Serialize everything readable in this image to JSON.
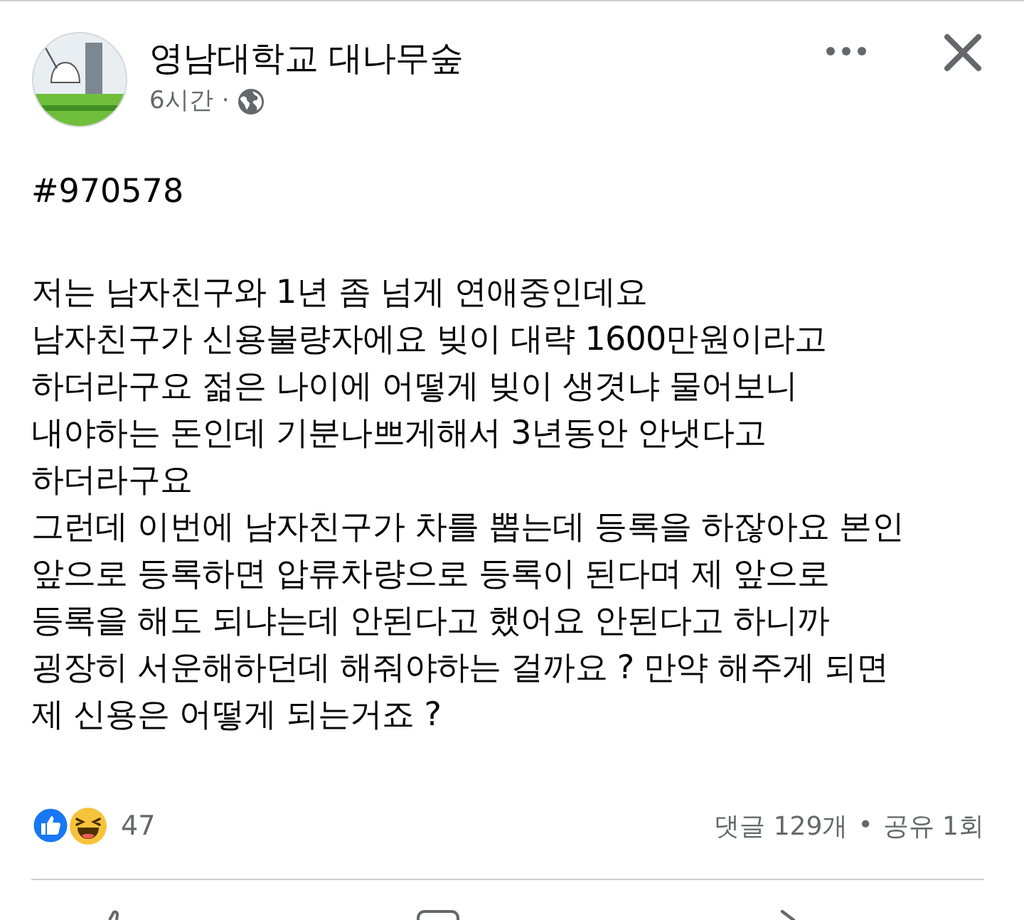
{
  "post": {
    "author": "영남대학교 대나무숲",
    "time": "6시간",
    "time_separator": "·",
    "post_id": "#970578",
    "body": "저는 남자친구와 1년 좀 넘게 연애중인데요\n남자친구가 신용불량자에요 빚이 대략 1600만원이라고\n하더라구요 젊은 나이에 어떻게 빚이 생겻냐 물어보니\n내야하는 돈인데 기분나쁘게해서 3년동안 안냇다고\n하더라구요\n그런데 이번에 남자친구가 차를 뽑는데 등록을 하잖아요 본인\n앞으로 등록하면 압류차량으로 등록이 된다며 제 앞으로\n등록을 해도 되냐는데 안된다고 했어요 안된다고 하니까\n굉장히 서운해하던데 해줘야하는 걸까요 ? 만약 해주게 되면\n제 신용은 어떻게 되는거죠 ?"
  },
  "reactions": {
    "types": [
      {
        "kind": "like"
      },
      {
        "kind": "haha"
      }
    ],
    "count": "47",
    "comments": "댓글 129개",
    "separator": "•",
    "shares": "공유 1회"
  }
}
